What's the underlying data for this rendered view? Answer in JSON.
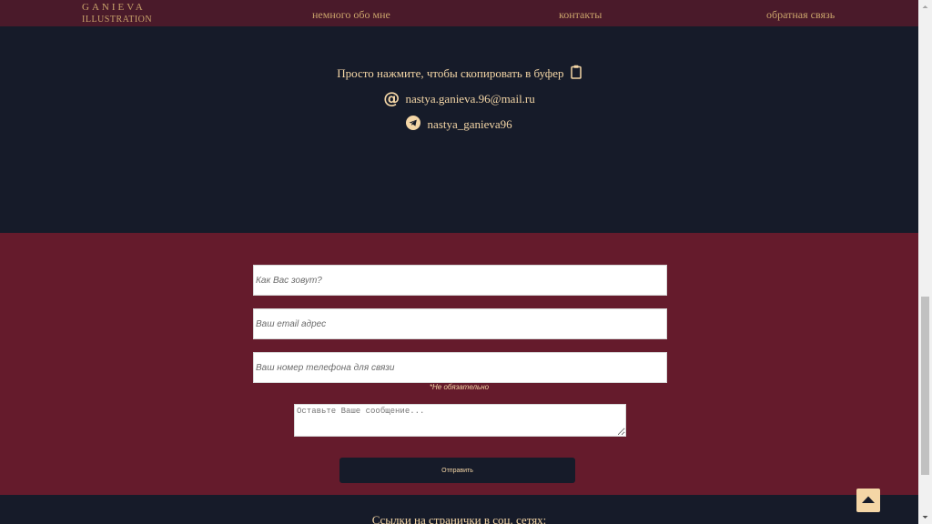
{
  "header": {
    "logo_line1": "GANIEVA",
    "logo_line2": "ILLUSTRATION",
    "nav": {
      "about": "немного обо мне",
      "contacts": "контакты",
      "feedback": "обратная связь"
    }
  },
  "contacts": {
    "copy_hint": "Просто нажмите, чтобы скопировать в буфер",
    "email": "nastya.ganieva.96@mail.ru",
    "telegram": "nastya_ganieva96"
  },
  "form": {
    "name_placeholder": "Как Вас зовут?",
    "email_placeholder": "Ваш email адрес",
    "phone_placeholder": "Ваш номер телефона для связи",
    "optional_note": "*Не обязательно",
    "message_placeholder": "Оставьте Ваше сообщение...",
    "submit_label": "Отправить"
  },
  "social": {
    "title": "Ссылки на странички в соц. сетях:"
  },
  "icons": {
    "clipboard": "clipboard-icon",
    "at": "at-icon",
    "telegram": "telegram-icon",
    "back_to_top": "arrow-up-icon"
  },
  "colors": {
    "navbar": "#4a1a2a",
    "dark": "#161b29",
    "burgundy": "#651b2c",
    "accent": "#f4d6a6",
    "nav_text": "#c9a36b"
  }
}
